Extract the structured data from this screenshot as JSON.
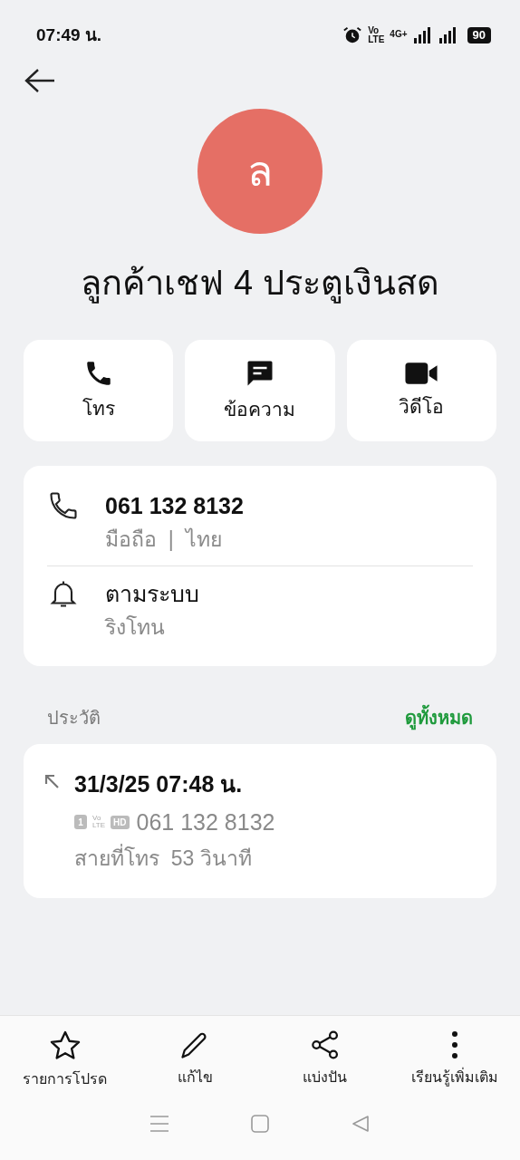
{
  "status_bar": {
    "time": "07:49 น.",
    "volte": [
      "Vo",
      "LTE"
    ],
    "network": "4G+",
    "battery": "90"
  },
  "contact": {
    "initial": "ล",
    "name": "ลูกค้าเชฟ 4 ประตูเงินสด"
  },
  "actions": [
    {
      "kind": "call",
      "label": "โทร"
    },
    {
      "kind": "message",
      "label": "ข้อความ"
    },
    {
      "kind": "video",
      "label": "วิดีโอ"
    }
  ],
  "details": [
    {
      "kind": "phone",
      "title": "061 132 8132",
      "subtitle": "มือถือ  |  ไทย"
    },
    {
      "kind": "ringtone",
      "title": "ตามระบบ",
      "subtitle": "ริงโทน"
    }
  ],
  "history": {
    "title": "ประวัติ",
    "see_all": "ดูทั้งหมด",
    "entries": [
      {
        "datetime": "31/3/25 07:48 น.",
        "sim": "1",
        "volte": [
          "Vo",
          "LTE"
        ],
        "hd": "HD",
        "number": "061 132 8132",
        "duration": "สายที่โทร  53 วินาที"
      }
    ]
  },
  "bottom_actions": [
    {
      "kind": "favorite",
      "label": "รายการโปรด"
    },
    {
      "kind": "edit",
      "label": "แก้ไข"
    },
    {
      "kind": "share",
      "label": "แบ่งปัน"
    },
    {
      "kind": "more",
      "label": "เรียนรู้เพิ่มเติม"
    }
  ]
}
